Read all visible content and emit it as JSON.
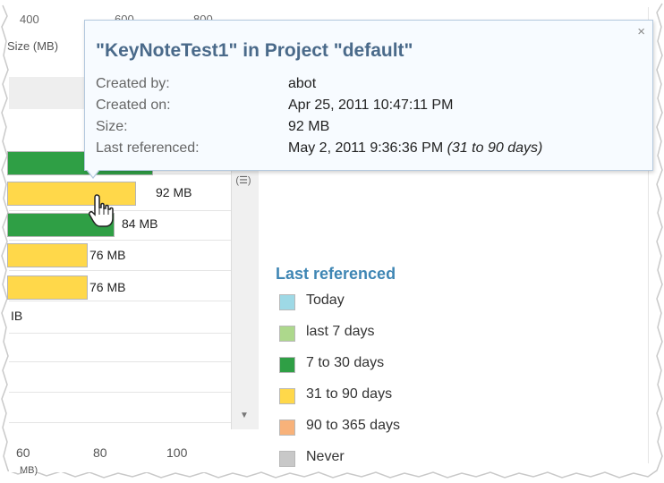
{
  "top_axis": {
    "ticks": [
      "400",
      "600",
      "800"
    ],
    "title": "Size (MB)"
  },
  "bars": [
    {
      "label": "",
      "color": "#2f9f45",
      "fraction": 0.67
    },
    {
      "label": "92 MB",
      "color": "#ffd84a",
      "fraction": 0.59
    },
    {
      "label": "84 MB",
      "color": "#2f9f45",
      "fraction": 0.49
    },
    {
      "label": "76 MB",
      "color": "#ffd84a",
      "fraction": 0.37
    },
    {
      "label": "76 MB",
      "color": "#ffd84a",
      "fraction": 0.37
    },
    {
      "label": "IB",
      "color": "",
      "fraction": 0
    }
  ],
  "bottom_axis": {
    "ticks": [
      "60",
      "80",
      "100"
    ],
    "title": "MB)"
  },
  "tooltip": {
    "title": "\"KeyNoteTest1\" in Project \"default\"",
    "close": "×",
    "rows": [
      {
        "label": "Created by:",
        "value": "abot",
        "note": ""
      },
      {
        "label": "Created on:",
        "value": "Apr 25, 2011 10:47:11 PM",
        "note": ""
      },
      {
        "label": "Size:",
        "value": "92 MB",
        "note": ""
      },
      {
        "label": "Last referenced:",
        "value": "May 2, 2011 9:36:36 PM ",
        "note": "(31 to 90 days)"
      }
    ]
  },
  "legend": {
    "title": "Last referenced",
    "items": [
      {
        "label": "Today",
        "color": "#9ed9e6"
      },
      {
        "label": "last 7 days",
        "color": "#add88c"
      },
      {
        "label": "7 to 30 days",
        "color": "#2f9f45"
      },
      {
        "label": "31 to 90 days",
        "color": "#ffd84a"
      },
      {
        "label": "90 to 365 days",
        "color": "#f8b27a"
      },
      {
        "label": "Never",
        "color": "#c8c8c8"
      }
    ]
  },
  "scroll": {
    "menu_icon": "menu-icon",
    "down_icon": "scroll-down-icon"
  }
}
